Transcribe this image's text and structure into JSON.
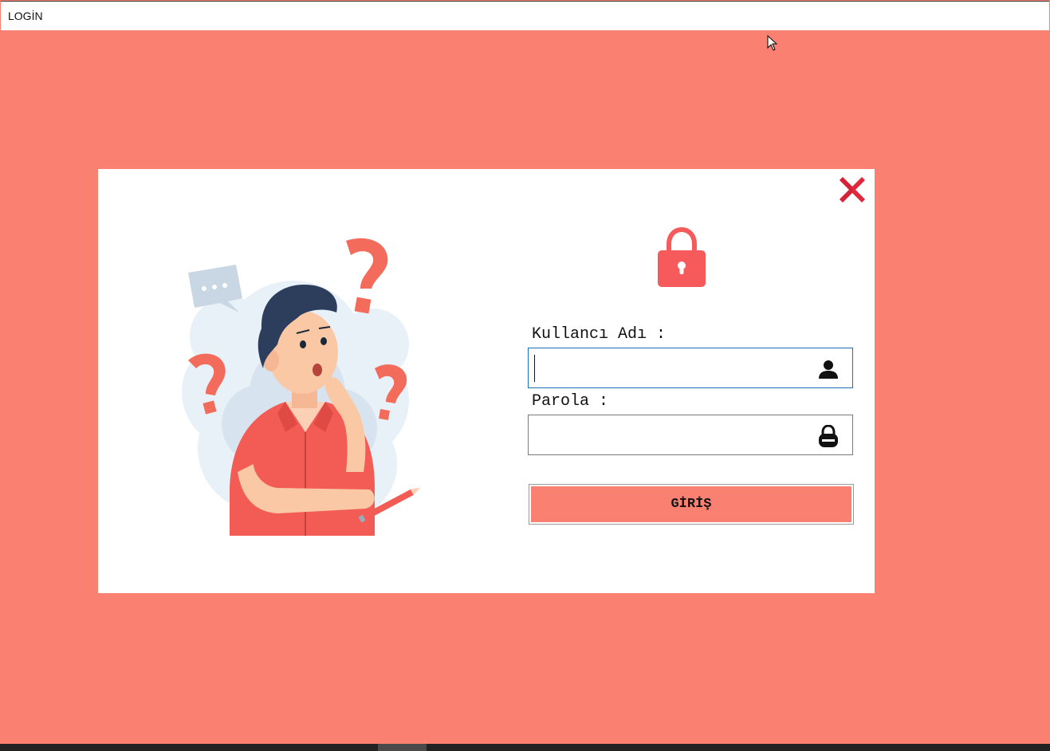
{
  "window": {
    "title": "LOGİN",
    "background_color": "#fa8072"
  },
  "login": {
    "username_label": "Kullancı Adı :",
    "username_value": "",
    "username_icon": "user-icon",
    "password_label": "Parola :",
    "password_value": "",
    "password_icon": "padlock-icon",
    "submit_label": "GİRİŞ",
    "header_icon": "lock-icon",
    "close_icon": "close-icon",
    "accent_color": "#fa8072",
    "close_color": "#e0283c"
  },
  "illustration": {
    "subject": "thinking-man-with-question-marks",
    "speech_bubble_text": "..."
  }
}
